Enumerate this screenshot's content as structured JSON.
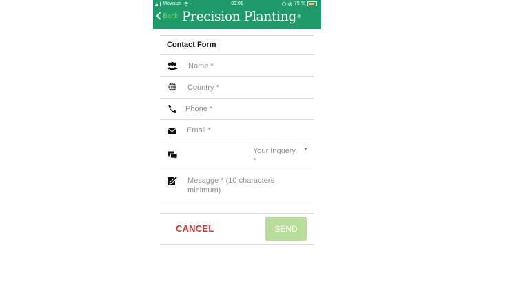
{
  "status_bar": {
    "carrier": "Movistar",
    "time": "09:01",
    "battery": "79 %",
    "battery_color": "#f2d21f"
  },
  "header": {
    "back_label": "Back",
    "brand": "Precision Planting",
    "brand_mark": "®",
    "color": "#1f9b6b"
  },
  "form": {
    "title": "Contact Form",
    "fields": {
      "name": {
        "placeholder": "Name *",
        "icon": "people-icon"
      },
      "country": {
        "placeholder": "Country *",
        "icon": "globe-icon"
      },
      "phone": {
        "placeholder": "Phone *",
        "icon": "phone-icon"
      },
      "email": {
        "placeholder": "Email *",
        "icon": "envelope-icon"
      },
      "inquiry": {
        "placeholder_line1": "Your Inquery",
        "placeholder_line2": "*",
        "icon": "chat-icon"
      },
      "message": {
        "placeholder_line1": "Mesagge * (10 characters",
        "placeholder_line2": "minimum)",
        "icon": "edit-icon"
      }
    }
  },
  "actions": {
    "cancel_label": "CANCEL",
    "send_label": "SEND",
    "cancel_color": "#d9362e",
    "send_color": "#b9dd9a"
  }
}
